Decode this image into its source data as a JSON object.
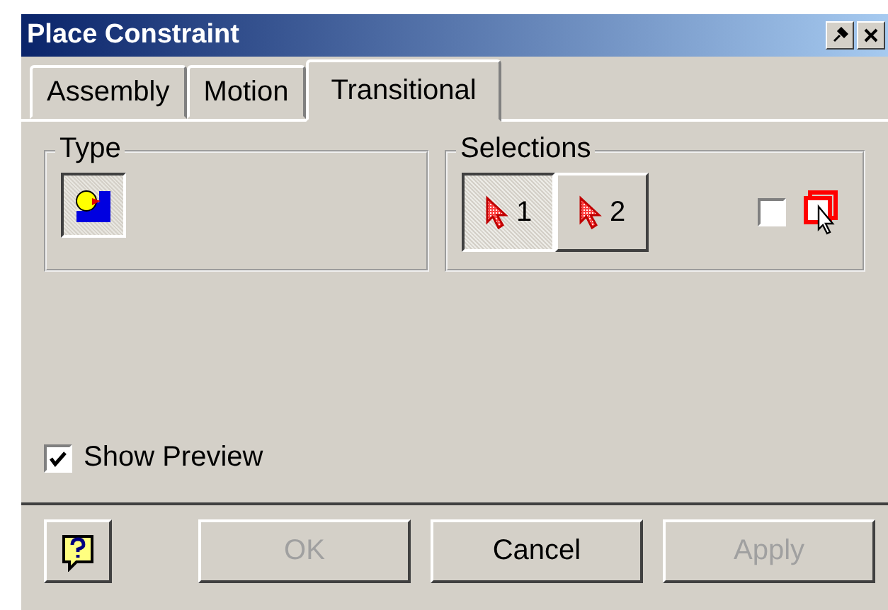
{
  "window": {
    "title": "Place Constraint"
  },
  "tabs": [
    {
      "label": "Assembly",
      "selected": false
    },
    {
      "label": "Motion",
      "selected": false
    },
    {
      "label": "Transitional",
      "selected": true
    }
  ],
  "type_group": {
    "label": "Type",
    "buttons": [
      {
        "selected": true
      }
    ]
  },
  "selections_group": {
    "label": "Selections",
    "buttons": [
      {
        "label": "1",
        "selected": true
      },
      {
        "label": "2",
        "selected": false
      }
    ],
    "checkbox": {
      "checked": false
    }
  },
  "show_preview": {
    "label": "Show Preview",
    "checked": true
  },
  "buttons": [
    {
      "kind": "help"
    },
    {
      "kind": "text",
      "label": "OK",
      "disabled": true
    },
    {
      "kind": "text",
      "label": "Cancel",
      "disabled": false
    },
    {
      "kind": "text",
      "label": "Apply",
      "disabled": true
    }
  ]
}
